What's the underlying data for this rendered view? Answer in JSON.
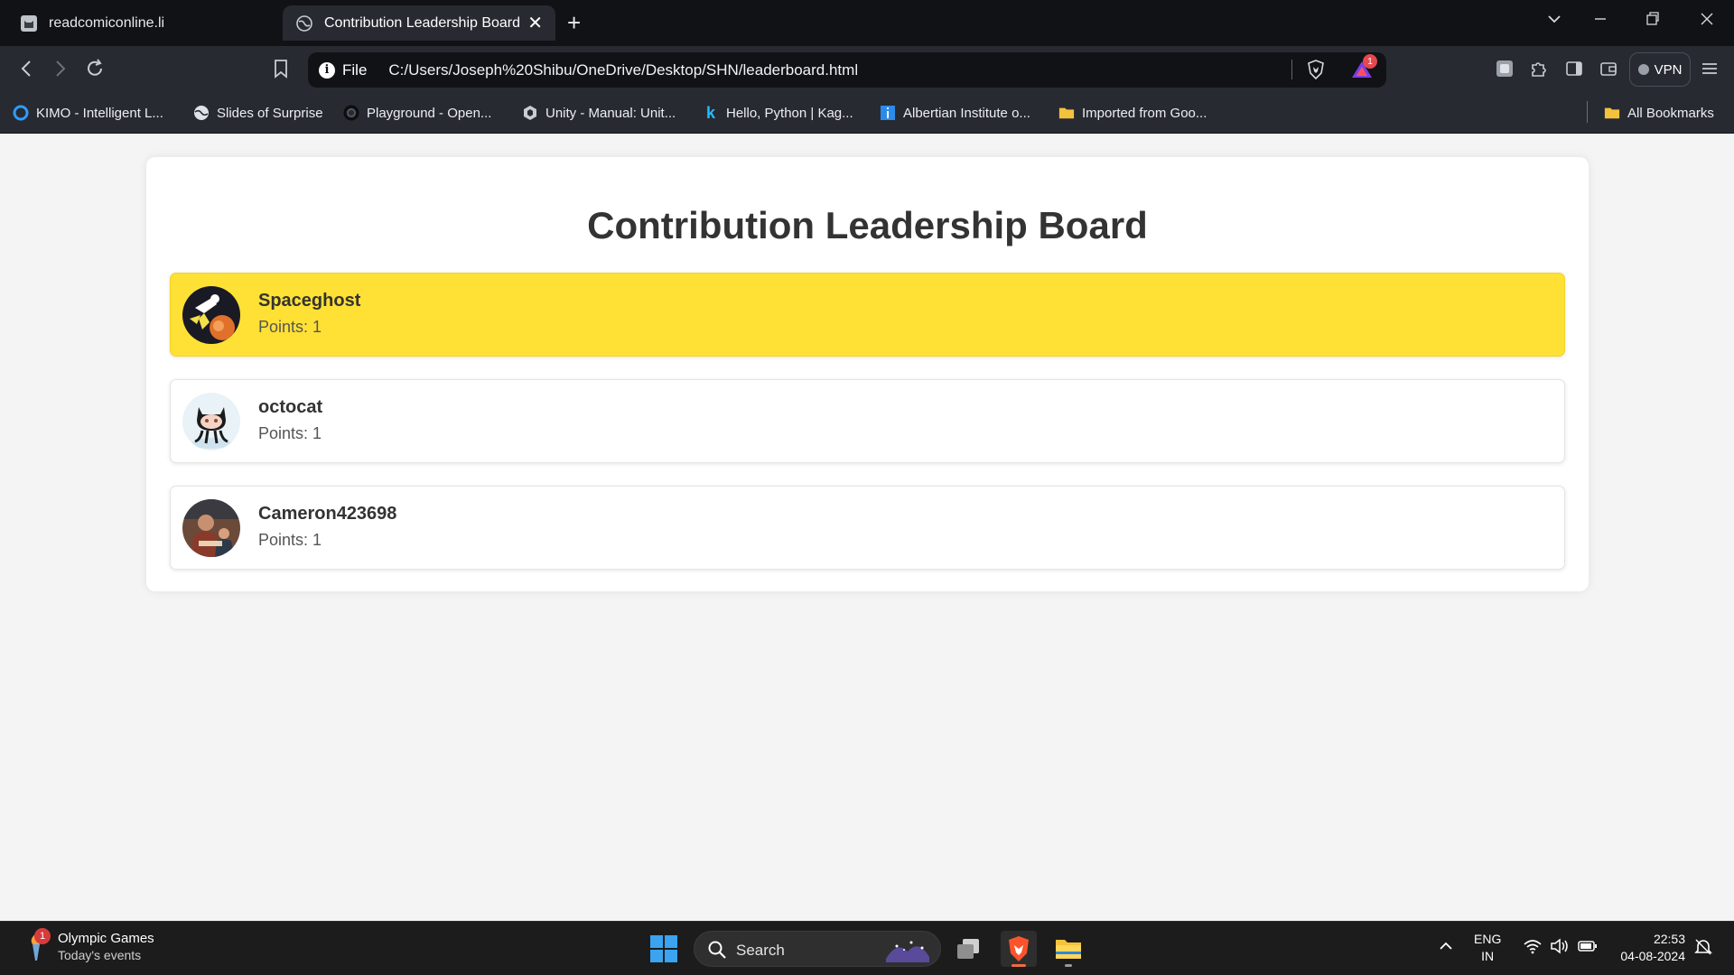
{
  "browser": {
    "tabs": [
      {
        "title": "readcomiconline.li",
        "active": false
      },
      {
        "title": "Contribution Leadership Board",
        "active": true
      }
    ],
    "address": {
      "scheme": "File",
      "url": "C:/Users/Joseph%20Shibu/OneDrive/Desktop/SHN/leaderboard.html"
    },
    "rewards_badge": "1",
    "vpn_label": "VPN",
    "bookmarks": [
      {
        "label": "KIMO - Intelligent L...",
        "icon": "kimo-icon"
      },
      {
        "label": "Slides of Surprise",
        "icon": "globe-icon"
      },
      {
        "label": "Playground - Open...",
        "icon": "openai-icon"
      },
      {
        "label": "Unity - Manual: Unit...",
        "icon": "unity-icon"
      },
      {
        "label": "Hello, Python | Kag...",
        "icon": "kaggle-icon"
      },
      {
        "label": "Albertian Institute o...",
        "icon": "info-icon"
      },
      {
        "label": "Imported from Goo...",
        "icon": "folder-icon"
      }
    ],
    "all_bookmarks": "All Bookmarks"
  },
  "page": {
    "title": "Contribution Leadership Board",
    "entries": [
      {
        "name": "Spaceghost",
        "points_text": "Points: 1",
        "avatar": "spaceghost-avatar",
        "highlight_color": "#ffe136"
      },
      {
        "name": "octocat",
        "points_text": "Points: 1",
        "avatar": "octocat-avatar"
      },
      {
        "name": "Cameron423698",
        "points_text": "Points: 1",
        "avatar": "photo-avatar"
      }
    ]
  },
  "taskbar": {
    "widget": {
      "title": "Olympic Games",
      "subtitle": "Today's events",
      "badge": "1"
    },
    "search_label": "Search",
    "language": {
      "line1": "ENG",
      "line2": "IN"
    },
    "clock": {
      "time": "22:53",
      "date": "04-08-2024"
    }
  },
  "colors": {
    "accent_yellow": "#ffe136",
    "chrome_dark": "#101216",
    "chrome_toolbar": "#272a31",
    "brave_orange": "#fb542b"
  }
}
